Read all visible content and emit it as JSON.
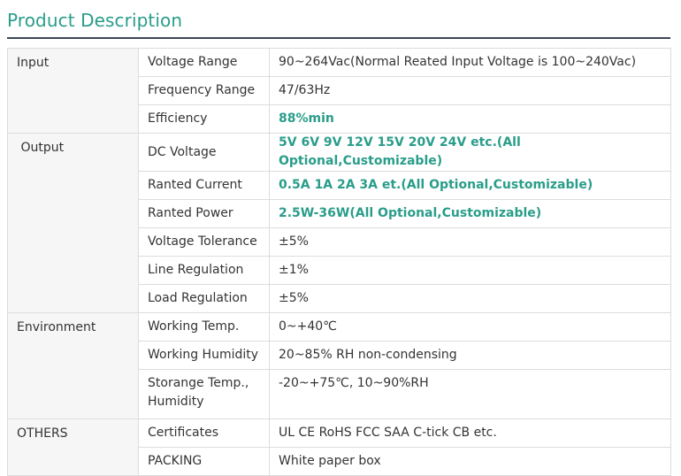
{
  "page": {
    "title": "Product Description"
  },
  "colors": {
    "accent": "#2a9d8a",
    "rule": "#3d4854",
    "border": "#dcdcdc",
    "group_bg": "#f6f6f6"
  },
  "groups": [
    {
      "name": "Input",
      "rows": [
        {
          "label": "Voltage Range",
          "value": "90~264Vac(Normal Reated Input Voltage is 100~240Vac)",
          "highlight": false
        },
        {
          "label": "Frequency Range",
          "value": "47/63Hz",
          "highlight": false
        },
        {
          "label": "Efficiency",
          "value": "88%min",
          "highlight": true
        }
      ]
    },
    {
      "name": " Output",
      "rows": [
        {
          "label": "DC Voltage",
          "value": "5V 6V 9V 12V 15V 20V 24V etc.(All Optional,Customizable)",
          "highlight": true
        },
        {
          "label": "Ranted Current",
          "value": "0.5A 1A 2A 3A et.(All Optional,Customizable)",
          "highlight": true
        },
        {
          "label": "Ranted Power",
          "value": "2.5W-36W(All Optional,Customizable)",
          "highlight": true
        },
        {
          "label": "Voltage Tolerance",
          "value": "±5%",
          "highlight": false
        },
        {
          "label": "Line Regulation",
          "value": "±1%",
          "highlight": false
        },
        {
          "label": "Load Regulation",
          "value": "±5%",
          "highlight": false
        }
      ]
    },
    {
      "name": "Environment",
      "rows": [
        {
          "label": "Working Temp.",
          "value": "0~+40℃",
          "highlight": false
        },
        {
          "label": "Working Humidity",
          "value": "20~85% RH non-condensing",
          "highlight": false
        },
        {
          "label": "Storange Temp., Humidity",
          "value": "-20~+75℃, 10~90%RH",
          "highlight": false
        }
      ]
    },
    {
      "name": "OTHERS",
      "rows": [
        {
          "label": "Certificates",
          "value": "UL CE RoHS FCC SAA C-tick CB etc.",
          "highlight": false
        },
        {
          "label": "PACKING",
          "value": "White paper box",
          "highlight": false
        }
      ]
    }
  ]
}
